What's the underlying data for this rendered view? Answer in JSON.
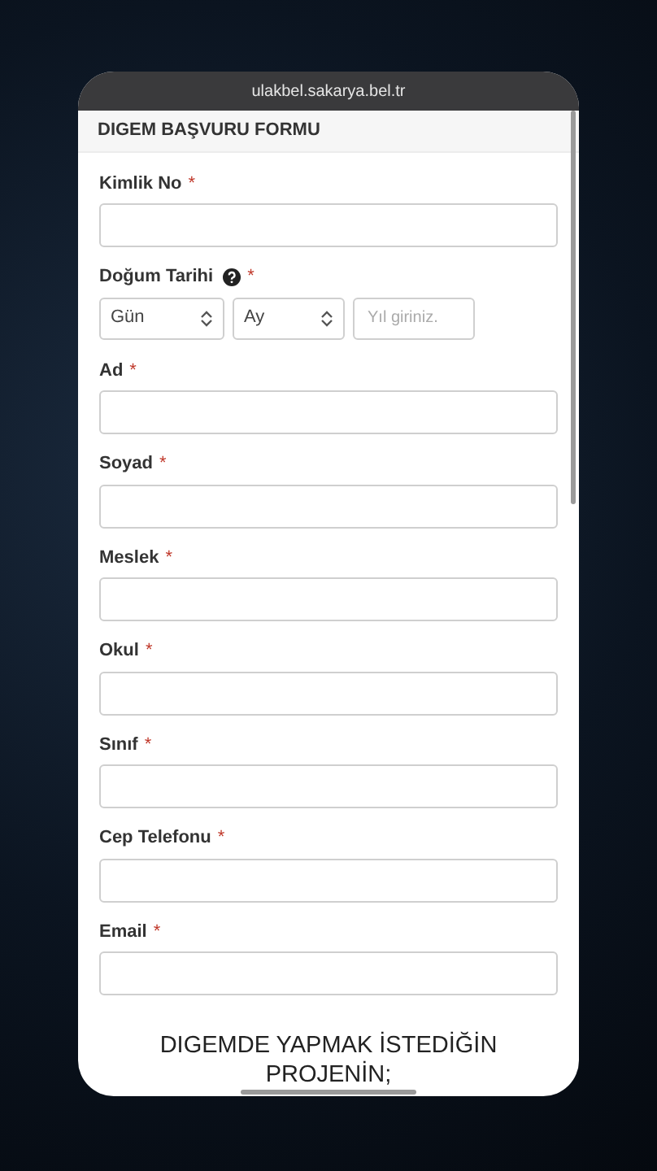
{
  "browser": {
    "url": "ulakbel.sakarya.bel.tr"
  },
  "form": {
    "title": "DIGEM BAŞVURU FORMU",
    "fields": [
      {
        "kind": "text",
        "label": "Kimlik No",
        "required_mark": "*"
      },
      {
        "kind": "date",
        "label": "Doğum Tarihi",
        "required_mark": "*",
        "day": "Gün",
        "month": "Ay",
        "year_placeholder": "Yıl giriniz."
      },
      {
        "kind": "text",
        "label": "Ad",
        "required_mark": "*"
      },
      {
        "kind": "text",
        "label": "Soyad",
        "required_mark": "*"
      },
      {
        "kind": "text",
        "label": "Meslek",
        "required_mark": "*"
      },
      {
        "kind": "text",
        "label": "Okul",
        "required_mark": "*"
      },
      {
        "kind": "text",
        "label": "Sınıf",
        "required_mark": "*"
      },
      {
        "kind": "text",
        "label": "Cep Telefonu",
        "required_mark": "*"
      },
      {
        "kind": "text",
        "label": "Email",
        "required_mark": "*"
      }
    ],
    "section_heading": "DIGEMDE YAPMAK İSTEDİĞİN PROJENİN;"
  }
}
